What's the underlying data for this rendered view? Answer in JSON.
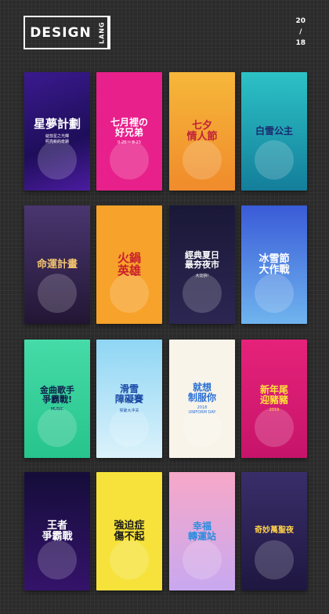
{
  "header": {
    "logo_main": "DESIGN",
    "logo_side": "LANG",
    "year_top": "20",
    "year_slash": "/",
    "year_bottom": "18"
  },
  "posters": [
    {
      "id": "p1",
      "title": "星夢計劃",
      "sub": "綻放星之光輝\n照亮新的奇蹟",
      "bg": "linear-gradient(160deg,#3b1a8f,#1e0e5a 60%,#4c1ca0)",
      "color": "#ffffff",
      "size": 15
    },
    {
      "id": "p2",
      "title": "七月裡の\n好兄弟",
      "sub": "0·25 ~ 8·23",
      "bg": "#e8208b",
      "color": "#ffffff",
      "size": 12
    },
    {
      "id": "p3",
      "title": "七夕\n情人節",
      "sub": "",
      "bg": "linear-gradient(180deg,#f6b73a,#f08b2b)",
      "color": "#c0213a",
      "size": 13
    },
    {
      "id": "p4",
      "title": "白雪公主",
      "sub": "",
      "bg": "linear-gradient(180deg,#2cc2c6,#147e9b)",
      "color": "#1a2a6e",
      "size": 12
    },
    {
      "id": "p5",
      "title": "命運計畫",
      "sub": "",
      "bg": "linear-gradient(180deg,#4a3670,#221634)",
      "color": "#f1c26d",
      "size": 13
    },
    {
      "id": "p6",
      "title": "火鍋\n英雄",
      "sub": "",
      "bg": "#f7a22a",
      "color": "#c8202e",
      "size": 15
    },
    {
      "id": "p7",
      "title": "經典夏日\n最夯夜市",
      "sub": "大比拚!",
      "bg": "linear-gradient(180deg,#1a1838,#2c2652)",
      "color": "#ffffff",
      "size": 11
    },
    {
      "id": "p8",
      "title": "冰雪節\n大作戰",
      "sub": "",
      "bg": "linear-gradient(180deg,#3a5bd8,#6fb4ee)",
      "color": "#ffffff",
      "size": 13
    },
    {
      "id": "p9",
      "title": "金曲歌手\n爭霸戰!",
      "sub": "MUSIC",
      "bg": "linear-gradient(180deg,#46dba8,#27c48d)",
      "color": "#0e1e4a",
      "size": 11
    },
    {
      "id": "p10",
      "title": "滑雪\n障礙賽",
      "sub": "突破大冲关",
      "bg": "linear-gradient(180deg,#8fd6f4,#dbf2fb)",
      "color": "#1b4aa5",
      "size": 12
    },
    {
      "id": "p11",
      "title": "就想\n制服你",
      "sub": "2018\nUNIFORM DAY",
      "bg": "#f8f4ea",
      "color": "#2a6fd6",
      "size": 12
    },
    {
      "id": "p12",
      "title": "新年尾\n迎豬豬",
      "sub": "2019",
      "bg": "linear-gradient(180deg,#e6227a,#c6146a)",
      "color": "#ffe23a",
      "size": 12
    },
    {
      "id": "p13",
      "title": "王者\n爭霸戰",
      "sub": "",
      "bg": "linear-gradient(180deg,#150d3a,#34136a)",
      "color": "#ffffff",
      "size": 13
    },
    {
      "id": "p14",
      "title": "強迫症\n傷不起",
      "sub": "",
      "bg": "#f6e23a",
      "color": "#1a1a1a",
      "size": 13
    },
    {
      "id": "p15",
      "title": "幸福\n轉運站",
      "sub": "",
      "bg": "linear-gradient(180deg,#f7a8c8,#c8a8f0)",
      "color": "#2a8ee0",
      "size": 12
    },
    {
      "id": "p16",
      "title": "奇妙萬聖夜",
      "sub": "",
      "bg": "linear-gradient(180deg,#3a2e6a,#1e1740)",
      "color": "#ffd24a",
      "size": 10
    }
  ],
  "colors": {
    "background": "#2b2b2b",
    "logo": "#ffffff"
  }
}
